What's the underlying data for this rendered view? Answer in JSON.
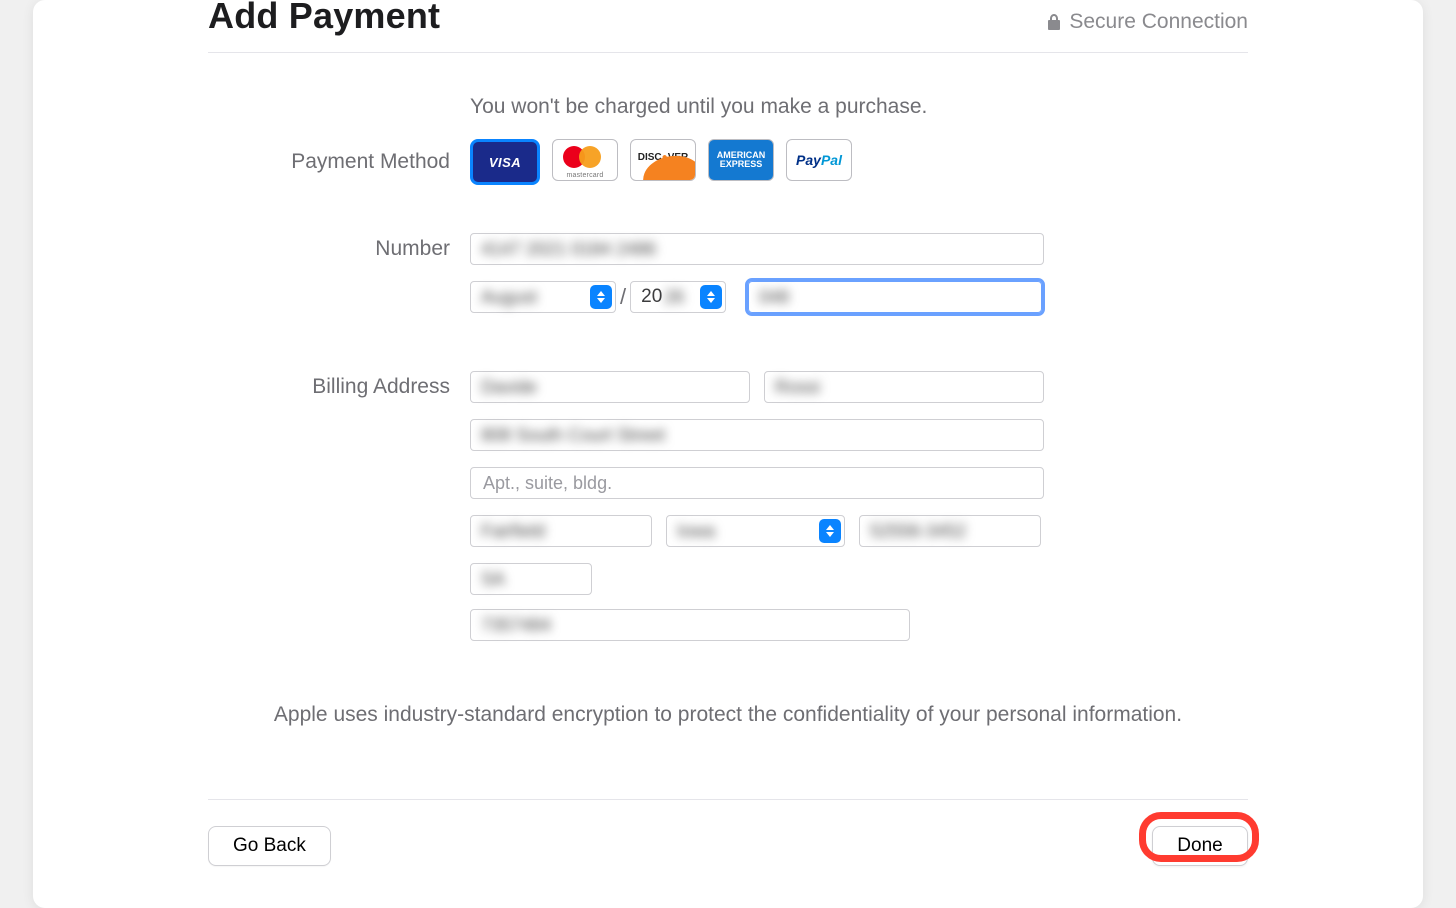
{
  "header": {
    "title": "Add Payment",
    "secure_label": "Secure Connection"
  },
  "intro": "You won't be charged until you make a purchase.",
  "labels": {
    "payment_method": "Payment Method",
    "number": "Number",
    "billing_address": "Billing Address"
  },
  "payment_methods": {
    "selected": "visa",
    "options": [
      "visa",
      "mastercard",
      "discover",
      "amex",
      "paypal"
    ]
  },
  "card": {
    "number_value": "4147 2021 0184 2486",
    "exp_month_value": "August",
    "exp_year_prefix": "20",
    "exp_year_suffix": "26",
    "cvv_value": "048"
  },
  "billing": {
    "first_name": "Davide",
    "last_name": "Rossi",
    "street1": "808 South Court Street",
    "street2_placeholder": "Apt., suite, bldg.",
    "street2_value": "",
    "city": "Fairfield",
    "state": "Iowa",
    "zip": "52556-3452",
    "country_code": "SA",
    "phone": "7357484"
  },
  "privacy_note": "Apple uses industry-standard encryption to protect the confidentiality of your personal information.",
  "footer": {
    "back_label": "Go Back",
    "done_label": "Done"
  }
}
